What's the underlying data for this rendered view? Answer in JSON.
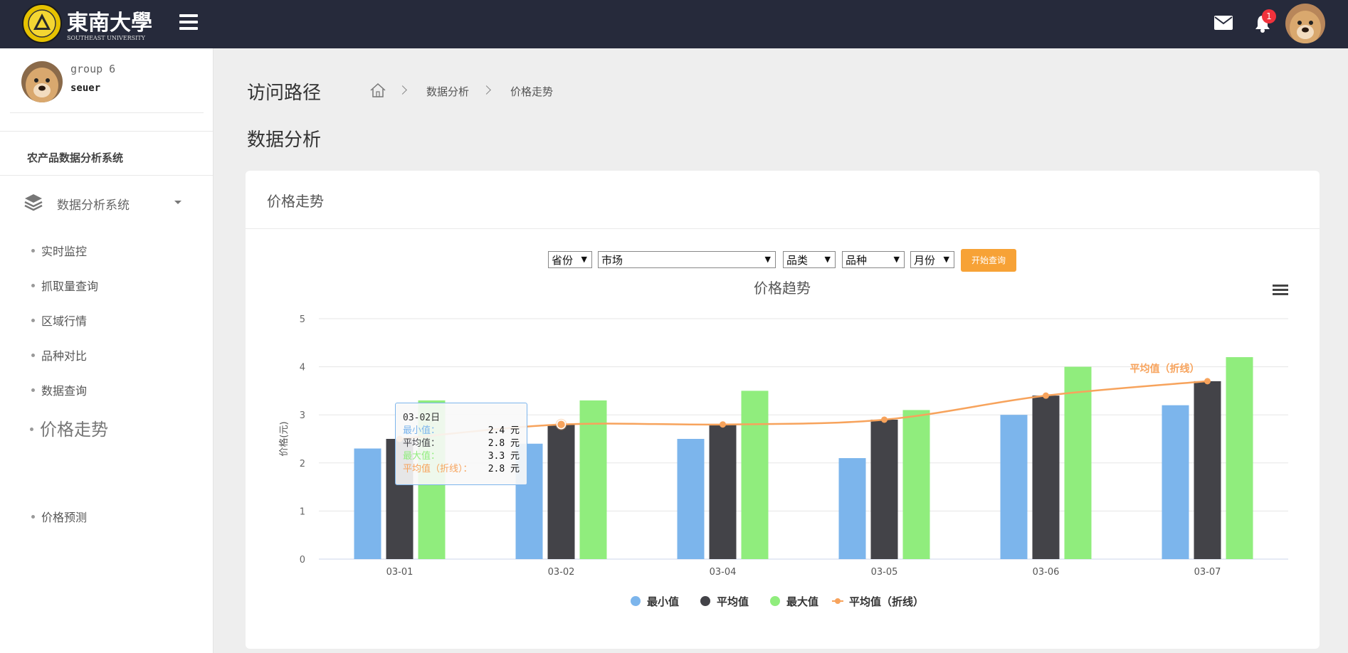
{
  "header": {
    "logo_alt": "东南大学 SOUTHEAST UNIVERSITY",
    "notification_count": "1",
    "icons": [
      "menu-icon",
      "envelope-icon",
      "bell-icon"
    ]
  },
  "sidebar": {
    "user_group": "group 6",
    "user_name": "seuer",
    "system_title": "农产品数据分析系统",
    "menu_group": "数据分析系统",
    "items": [
      {
        "label": "实时监控"
      },
      {
        "label": "抓取量查询"
      },
      {
        "label": "区域行情"
      },
      {
        "label": "品种对比"
      },
      {
        "label": "数据查询"
      },
      {
        "label": "价格走势",
        "active": true
      },
      {
        "label": "价格预测"
      }
    ]
  },
  "breadcrumb": {
    "title": "访问路径",
    "links": [
      "数据分析",
      "价格走势"
    ]
  },
  "page_title": "数据分析",
  "card_title": "价格走势",
  "filters": {
    "province": "省份",
    "market": "市场",
    "category": "品类",
    "variety": "品种",
    "month": "月份",
    "query_button": "开始查询"
  },
  "colors": {
    "min": "#7cb5ec",
    "avg": "#434348",
    "max": "#90ed7d",
    "line": "#f7a35c",
    "accent_button": "#f7a236",
    "topbar": "#262a3b"
  },
  "chart_data": {
    "type": "bar",
    "title": "价格趋势",
    "ylabel": "价格(元)",
    "xlabel": "",
    "ylim": [
      0,
      5
    ],
    "yticks": [
      "0",
      "1",
      "2",
      "3",
      "4",
      "5"
    ],
    "categories": [
      "03-01",
      "03-02",
      "03-04",
      "03-05",
      "03-06",
      "03-07"
    ],
    "series": [
      {
        "name": "最小值",
        "type": "bar",
        "values": [
          2.3,
          2.4,
          2.5,
          2.1,
          3.0,
          3.2
        ]
      },
      {
        "name": "平均值",
        "type": "bar",
        "values": [
          2.5,
          2.8,
          2.8,
          2.9,
          3.4,
          3.7
        ]
      },
      {
        "name": "最大值",
        "type": "bar",
        "values": [
          3.3,
          3.3,
          3.5,
          3.1,
          4.0,
          4.2
        ]
      },
      {
        "name": "平均值（折线）",
        "type": "line",
        "values": [
          2.5,
          2.8,
          2.8,
          2.9,
          3.4,
          3.7
        ]
      }
    ],
    "line_label": "平均值（折线）",
    "grid": true,
    "legend_position": "bottom",
    "tooltip": {
      "category": "03-02日",
      "rows": [
        {
          "label": "最小值：",
          "value": "2.4 元"
        },
        {
          "label": "平均值：",
          "value": "2.8 元"
        },
        {
          "label": "最大值：",
          "value": "3.3 元"
        },
        {
          "label": "平均值（折线）：",
          "value": "2.8 元"
        }
      ]
    }
  }
}
